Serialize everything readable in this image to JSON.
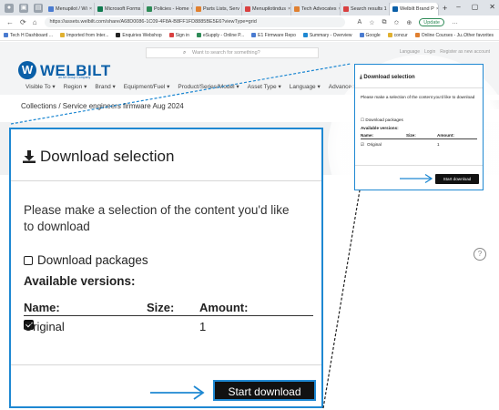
{
  "browser": {
    "tabs": [
      {
        "label": "Menupilot / Wi",
        "color": "#4a7bd0"
      },
      {
        "label": "Microsoft Forms",
        "color": "#0f7a4f"
      },
      {
        "label": "Policies - Home",
        "color": "#2e8b57"
      },
      {
        "label": "Parts Lists, Serv",
        "color": "#e08030"
      },
      {
        "label": "Menupilotindus",
        "color": "#d94040"
      },
      {
        "label": "Tech Advocates",
        "color": "#e08030"
      },
      {
        "label": "Search results 1",
        "color": "#d94040"
      },
      {
        "label": "Welbilt Brand P",
        "color": "#0a5fa8"
      }
    ],
    "url": "https://assets.welbilt.com/share/A68D0086-1C09-4F8A-B8FF1FD8885BE5E6?viewType=grid",
    "update_label": "Update",
    "favorites": [
      {
        "label": "Tech H Dashboard ...",
        "color": "#4a7bd0"
      },
      {
        "label": "Imported from Inter...",
        "color": "#e0b030"
      },
      {
        "label": "Enquiries Webshop",
        "color": "#222222"
      },
      {
        "label": "Sign in",
        "color": "#d94040"
      },
      {
        "label": "eSupply - Online P...",
        "color": "#2e8b57"
      },
      {
        "label": "E1 Firmware Repo",
        "color": "#4a7bd0"
      },
      {
        "label": "Summary - Overview",
        "color": "#1e88d2"
      },
      {
        "label": "Google",
        "color": "#4a7bd0"
      },
      {
        "label": "concur",
        "color": "#e0b030"
      },
      {
        "label": "Online Courses - Ju...",
        "color": "#e08030"
      }
    ],
    "other_favorites": "Other favorites"
  },
  "site": {
    "search_placeholder": "Want to search for something?",
    "top_links": [
      "Language",
      "Login",
      "Register as new account"
    ],
    "logo_text": "WELBILT",
    "logo_sub": "an Ali Group Company",
    "nav": [
      "Visible To",
      "Region",
      "Brand",
      "Equipment/Fuel",
      "Product/Series/Model",
      "Asset Type",
      "Language",
      "Advanced"
    ],
    "breadcrumb": "Collections / Service engineers firmware Aug 2024"
  },
  "dialog": {
    "title": "Download selection",
    "message": "Please make a selection of the content you'd like to download",
    "download_packages": "Download packages",
    "available_versions": "Available versions:",
    "columns": {
      "name": "Name:",
      "size": "Size:",
      "amount": "Amount:"
    },
    "rows": [
      {
        "name": "Original",
        "size": "",
        "amount": "1",
        "checked": true
      }
    ],
    "start_button": "Start download"
  },
  "colors": {
    "accent": "#1e88d2",
    "brand": "#0a5fa8",
    "button": "#111111"
  }
}
